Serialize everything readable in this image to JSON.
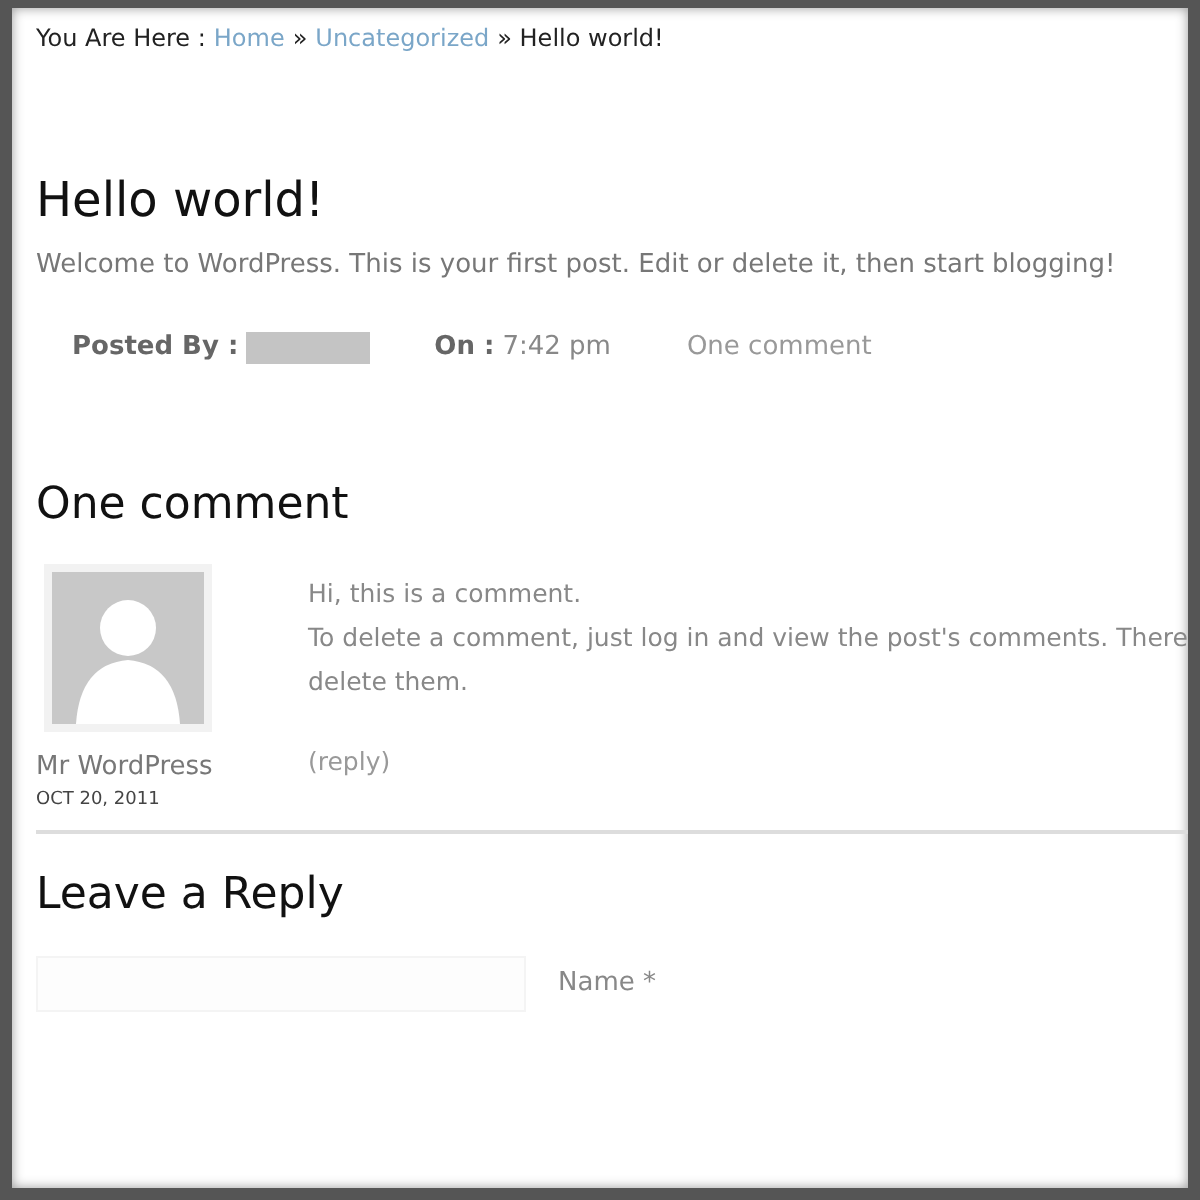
{
  "breadcrumb": {
    "prefix": "You Are Here :",
    "items": [
      {
        "label": "Home",
        "kind": "link"
      },
      {
        "label": "»",
        "kind": "sep"
      },
      {
        "label": "Uncategorized",
        "kind": "link"
      },
      {
        "label": "» Hello world!",
        "kind": "current"
      }
    ]
  },
  "post": {
    "title": "Hello world!",
    "body": "Welcome to WordPress. This is your first post. Edit or delete it, then start blogging!",
    "meta": {
      "posted_by_label": "Posted By :",
      "author_hidden": true,
      "on_label": "On :",
      "time": "7:42 pm",
      "comments_link": "One comment"
    }
  },
  "comments": {
    "heading": "One comment",
    "items": [
      {
        "author": "Mr WordPress",
        "date": "OCT 20, 2011",
        "lines": [
          "Hi, this is a comment.",
          "To delete a comment, just log in and view the post's comments. There",
          "delete them."
        ],
        "reply": "(reply)"
      }
    ]
  },
  "reply_form": {
    "heading": "Leave a Reply",
    "fields": [
      {
        "label": "Name *"
      }
    ]
  }
}
